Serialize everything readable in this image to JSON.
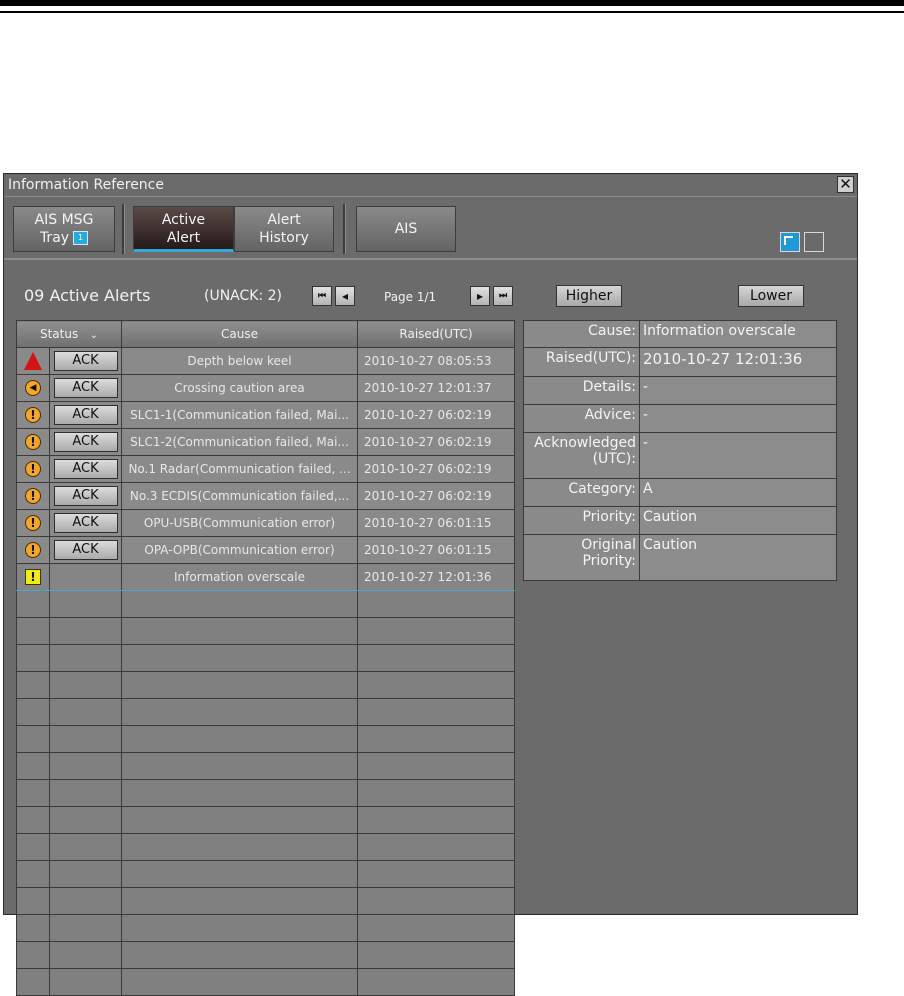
{
  "window": {
    "title": "Information Reference",
    "close_glyph": "✕"
  },
  "toolbar": {
    "ais_msg_tray": {
      "line1": "AIS MSG",
      "line2": "Tray",
      "badge": "1"
    },
    "active_alert": {
      "line1": "Active",
      "line2": "Alert"
    },
    "alert_history": {
      "line1": "Alert",
      "line2": "History"
    },
    "ais": "AIS"
  },
  "summary": {
    "count_text": "09 Active Alerts",
    "unack_text": "(UNACK: 2)",
    "page_text": "Page 1/1",
    "higher": "Higher",
    "lower": "Lower"
  },
  "nav": {
    "first": "⏮",
    "prev": "◂",
    "next": "▸",
    "last": "⏭"
  },
  "table": {
    "headers": {
      "status": "Status",
      "status_sort": "⌄",
      "cause": "Cause",
      "raised": "Raised(UTC)"
    },
    "rows": [
      {
        "icon": "triangle-icon",
        "ack": "ACK",
        "cause": "Depth below keel",
        "raised": "2010-10-27 08:05:53"
      },
      {
        "icon": "speaker-icon",
        "ack": "ACK",
        "cause": "Crossing caution area",
        "raised": "2010-10-27 12:01:37",
        "glyph": "◀"
      },
      {
        "icon": "exclamation-circle-icon",
        "ack": "ACK",
        "cause": "SLC1-1(Communication failed, Mai...",
        "raised": "2010-10-27 06:02:19",
        "glyph": "!"
      },
      {
        "icon": "exclamation-circle-icon",
        "ack": "ACK",
        "cause": "SLC1-2(Communication failed, Mai...",
        "raised": "2010-10-27 06:02:19",
        "glyph": "!"
      },
      {
        "icon": "exclamation-circle-icon",
        "ack": "ACK",
        "cause": "No.1 Radar(Communication failed, ...",
        "raised": "2010-10-27 06:02:19",
        "glyph": "!"
      },
      {
        "icon": "exclamation-circle-icon",
        "ack": "ACK",
        "cause": "No.3 ECDIS(Communication failed,...",
        "raised": "2010-10-27 06:02:19",
        "glyph": "!"
      },
      {
        "icon": "exclamation-circle-icon",
        "ack": "ACK",
        "cause": "OPU-USB(Communication error)",
        "raised": "2010-10-27 06:01:15",
        "glyph": "!"
      },
      {
        "icon": "exclamation-circle-icon",
        "ack": "ACK",
        "cause": "OPA-OPB(Communication error)",
        "raised": "2010-10-27 06:01:15",
        "glyph": "!"
      },
      {
        "icon": "exclamation-square-icon",
        "ack": "",
        "cause": "Information overscale",
        "raised": "2010-10-27 12:01:36",
        "glyph": "!"
      }
    ]
  },
  "detail": {
    "cause_label": "Cause:",
    "cause_value": "Information overscale",
    "raised_label": "Raised(UTC):",
    "raised_value": "2010-10-27 12:01:36",
    "details_label": "Details:",
    "details_value": "-",
    "advice_label": "Advice:",
    "advice_value": "-",
    "ack_label_1": "Acknowledged",
    "ack_label_2": "(UTC):",
    "ack_value": "-",
    "category_label": "Category:",
    "category_value": "A",
    "priority_label": "Priority:",
    "priority_value": "Caution",
    "orig_label_1": "Original",
    "orig_label_2": "Priority:",
    "orig_value": "Caution"
  }
}
